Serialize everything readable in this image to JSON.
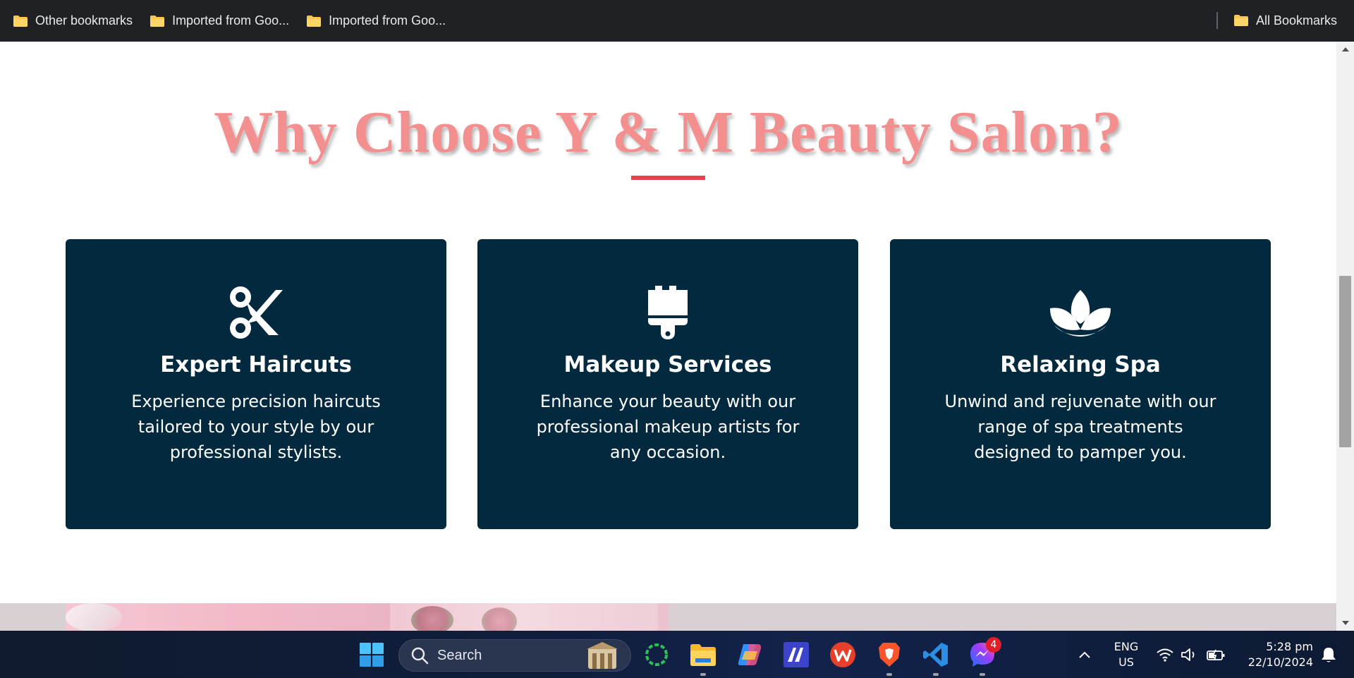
{
  "bookmarks_bar": {
    "items": [
      {
        "label": "Other bookmarks"
      },
      {
        "label": "Imported from Goo..."
      },
      {
        "label": "Imported from Goo..."
      }
    ],
    "all_bookmarks_label": "All Bookmarks"
  },
  "section": {
    "headline": "Why Choose Y & M Beauty Salon?",
    "accent_color": "#e8414d",
    "headline_color": "#f48f8f",
    "card_color": "#02293d",
    "cards": [
      {
        "icon": "scissors-icon",
        "title": "Expert Haircuts",
        "description": "Experience precision haircuts tailored to your style by our professional stylists."
      },
      {
        "icon": "paint-brush-icon",
        "title": "Makeup Services",
        "description": "Enhance your beauty with our professional makeup artists for any occasion."
      },
      {
        "icon": "lotus-icon",
        "title": "Relaxing Spa",
        "description": "Unwind and rejuvenate with our range of spa treatments designed to pamper you."
      }
    ]
  },
  "taskbar": {
    "search_placeholder": "Search",
    "apps": [
      "windows-start-icon",
      "search",
      "loading-app-icon",
      "file-explorer-icon",
      "copilot-icon",
      "wing-ide-icon",
      "wps-office-icon",
      "brave-browser-icon",
      "vscode-icon",
      "messenger-icon"
    ],
    "messenger_badge": "4",
    "language": "ENG",
    "region": "US",
    "time": "5:28 pm",
    "date": "22/10/2024"
  }
}
